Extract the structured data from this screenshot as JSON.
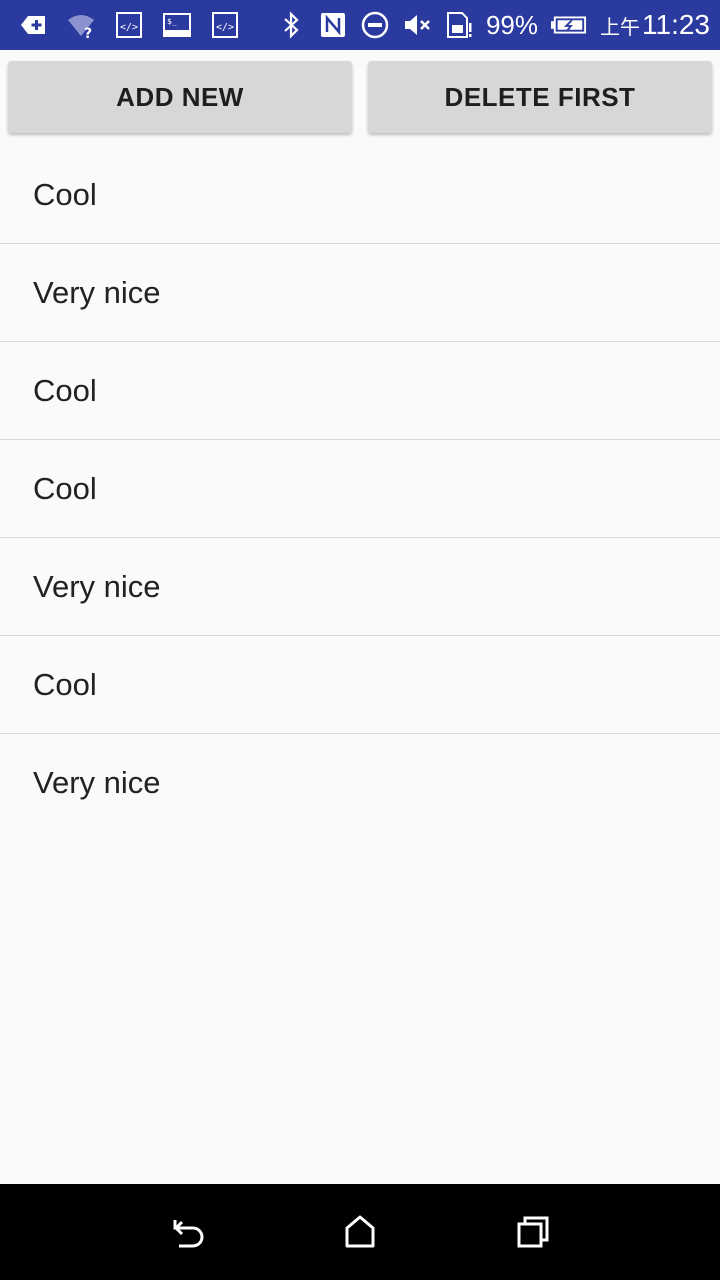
{
  "status_bar": {
    "left_icons": [
      "download-plus-icon",
      "wifi-unknown-icon",
      "code-icon",
      "terminal-icon",
      "code-icon"
    ],
    "right_icons": [
      "bluetooth-icon",
      "nfc-icon",
      "do-not-disturb-icon",
      "volume-mute-icon",
      "sim-alert-icon"
    ],
    "battery_percent": "99%",
    "time_prefix": "上午",
    "time": "11:23",
    "background_color": "#2b3a9e"
  },
  "toolbar": {
    "add_label": "ADD NEW",
    "delete_label": "DELETE FIRST"
  },
  "list": {
    "items": [
      "Cool",
      "Very nice",
      "Cool",
      "Cool",
      "Very nice",
      "Cool",
      "Very nice"
    ]
  },
  "nav_bar": {
    "icons": [
      "back-icon",
      "home-icon",
      "recents-icon"
    ]
  }
}
